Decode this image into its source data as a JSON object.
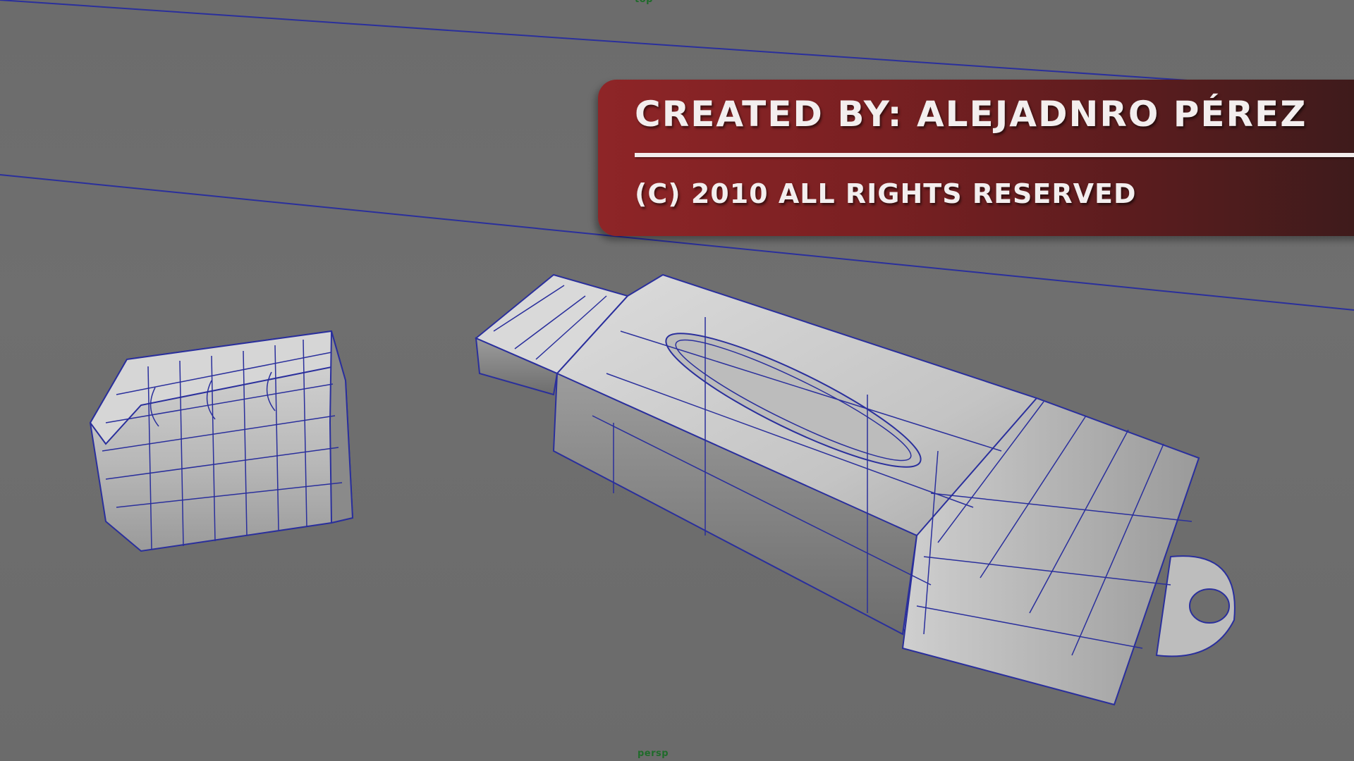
{
  "viewport": {
    "camera_top_label": "top",
    "camera_bottom_label": "persp",
    "background_color": "#6f6f6f",
    "wire_color": "#2a2f9c"
  },
  "banner": {
    "title": "CREATED BY: ALEJADNRO PÉREZ",
    "copyright": "(C) 2010 ALL RIGHTS RESERVED",
    "color": "#8e2527"
  },
  "models": {
    "usb_body": "usb-drive-body-mesh",
    "usb_cap": "usb-cap-mesh"
  }
}
